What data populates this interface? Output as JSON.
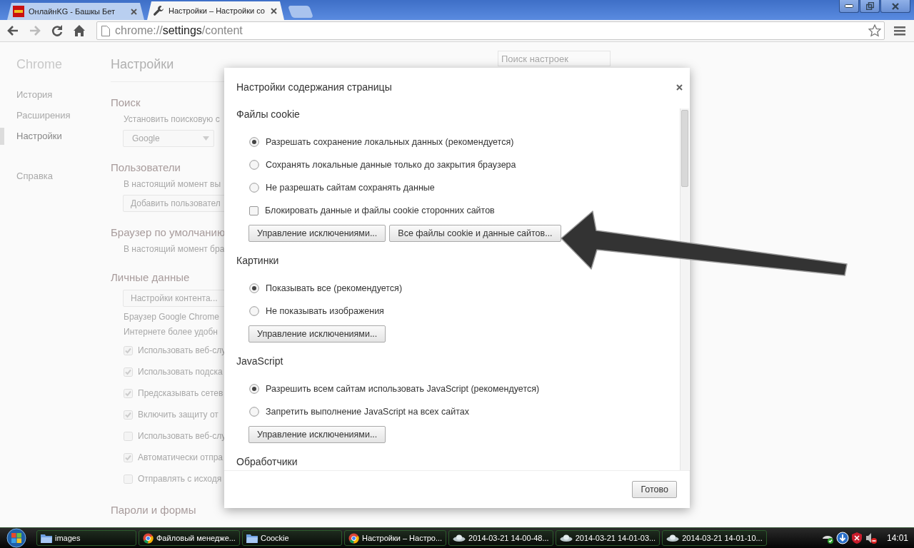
{
  "browser": {
    "tabs": [
      {
        "title": "ОнлайнKG - Башкы Бет",
        "kind": "site",
        "selected": false
      },
      {
        "title": "Настройки – Настройки со",
        "kind": "tool",
        "selected": true
      }
    ],
    "address": [
      {
        "text": "chrome://",
        "strong": false
      },
      {
        "text": "settings",
        "strong": true
      },
      {
        "text": "/content",
        "strong": false
      }
    ],
    "nav": [
      {
        "kind": "back",
        "disabled": false
      },
      {
        "kind": "forward",
        "disabled": true
      },
      {
        "kind": "reload",
        "disabled": false
      },
      {
        "kind": "home",
        "disabled": false
      }
    ]
  },
  "sidebar": {
    "title": "Chrome",
    "items": [
      {
        "label": "История",
        "selected": false
      },
      {
        "label": "Расширения",
        "selected": false
      },
      {
        "label": "Настройки",
        "selected": true
      },
      {
        "label": "Справка",
        "selected": false
      }
    ]
  },
  "settings": {
    "title": "Настройки",
    "search": {
      "placeholder": "Поиск настроек"
    },
    "blocks": [
      {
        "kind": "heading",
        "text": "Поиск"
      },
      {
        "kind": "text",
        "text": "Установить поисковую с"
      },
      {
        "kind": "select",
        "text": "Google"
      },
      {
        "kind": "heading",
        "text": "Пользователи"
      },
      {
        "kind": "text",
        "text": "В настоящий момент вы"
      },
      {
        "kind": "button",
        "text": "Добавить пользовател"
      },
      {
        "kind": "heading",
        "text": "Браузер по умолчанию"
      },
      {
        "kind": "text",
        "text": "В настоящий момент бра"
      },
      {
        "kind": "heading",
        "text": "Личные данные"
      },
      {
        "kind": "button",
        "text": "Настройки контента..."
      },
      {
        "kind": "text",
        "text": "Браузер Google Chrome"
      },
      {
        "kind": "text",
        "text": "Интернете более удобн"
      },
      {
        "kind": "checkbox",
        "text": "Использовать веб-слу",
        "checked": true
      },
      {
        "kind": "checkbox",
        "text": "Использовать подска",
        "checked": true
      },
      {
        "kind": "checkbox",
        "text": "Предсказывать сетев",
        "checked": true
      },
      {
        "kind": "checkbox",
        "text": "Включить защиту от",
        "checked": true
      },
      {
        "kind": "checkbox",
        "text": "Использовать веб-слу",
        "checked": false
      },
      {
        "kind": "checkbox",
        "text": "Автоматически отпра",
        "checked": true
      },
      {
        "kind": "checkbox",
        "text": "Отправлять с исходя",
        "checked": false
      },
      {
        "kind": "heading",
        "text": "Пароли и формы"
      }
    ]
  },
  "dialog": {
    "title": "Настройки содержания страницы",
    "sections": [
      {
        "heading": "Файлы cookie",
        "options": [
          {
            "kind": "radio",
            "label": "Разрешать сохранение локальных данных (рекомендуется)",
            "selected": true
          },
          {
            "kind": "radio",
            "label": "Сохранять локальные данные только до закрытия браузера",
            "selected": false
          },
          {
            "kind": "radio",
            "label": "Не разрешать сайтам сохранять данные",
            "selected": false
          },
          {
            "kind": "checkbox",
            "label": "Блокировать данные и файлы cookie сторонних сайтов",
            "selected": false
          }
        ],
        "buttons": [
          "Управление исключениями...",
          "Все файлы cookie и данные сайтов..."
        ]
      },
      {
        "heading": "Картинки",
        "options": [
          {
            "kind": "radio",
            "label": "Показывать все (рекомендуется)",
            "selected": true
          },
          {
            "kind": "radio",
            "label": "Не показывать изображения",
            "selected": false
          }
        ],
        "buttons": [
          "Управление исключениями..."
        ]
      },
      {
        "heading": "JavaScript",
        "options": [
          {
            "kind": "radio",
            "label": "Разрешить всем сайтам использовать JavaScript (рекомендуется)",
            "selected": true
          },
          {
            "kind": "radio",
            "label": "Запретить выполнение JavaScript на всех сайтах",
            "selected": false
          }
        ],
        "buttons": [
          "Управление исключениями..."
        ]
      },
      {
        "heading": "Обработчики"
      }
    ],
    "done": "Готово"
  },
  "taskbar": {
    "items": [
      {
        "kind": "folder",
        "label": "images"
      },
      {
        "kind": "browser",
        "label": "Файловый менедже..."
      },
      {
        "kind": "folder",
        "label": "Coockie"
      },
      {
        "kind": "browser",
        "label": "Настройки – Настро..."
      },
      {
        "kind": "image",
        "label": "2014-03-21 14-00-48..."
      },
      {
        "kind": "image",
        "label": "2014-03-21 14-01-03..."
      },
      {
        "kind": "image",
        "label": "2014-03-21 14-01-10..."
      }
    ],
    "clock": "14:01"
  }
}
